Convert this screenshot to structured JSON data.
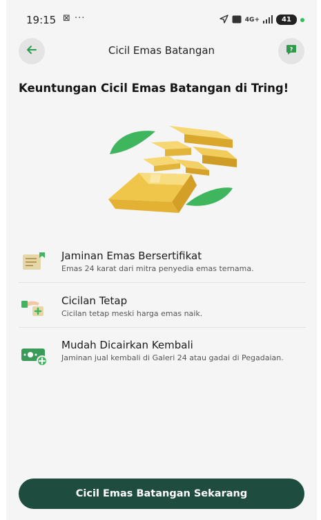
{
  "status_bar": {
    "time": "19:15",
    "left_icons": "⊠ ···",
    "network": "4G+",
    "battery": "41"
  },
  "header": {
    "title": "Cicil Emas Batangan",
    "back_icon": "arrow-left-icon",
    "help_icon": "question-icon"
  },
  "heading": "Keuntungan Cicil Emas Batangan di Tring!",
  "hero": {
    "icon": "gold-bars-illustration"
  },
  "benefits": [
    {
      "icon": "certificate-icon",
      "title": "Jaminan Emas Bersertifikat",
      "description": "Emas 24 karat dari mitra penyedia emas ternama."
    },
    {
      "icon": "hand-money-icon",
      "title": "Cicilan Tetap",
      "description": "Cicilan tetap meski harga emas naik."
    },
    {
      "icon": "cash-plus-icon",
      "title": "Mudah Dicairkan Kembali",
      "description": "Jaminan jual kembali di Galeri 24 atau gadai di Pegadaian."
    }
  ],
  "cta_label": "Cicil Emas Batangan Sekarang",
  "colors": {
    "primary": "#1e4d3f",
    "accent_green": "#3fb55e",
    "gold": "#f0c64a",
    "background": "#f5f5f5"
  }
}
